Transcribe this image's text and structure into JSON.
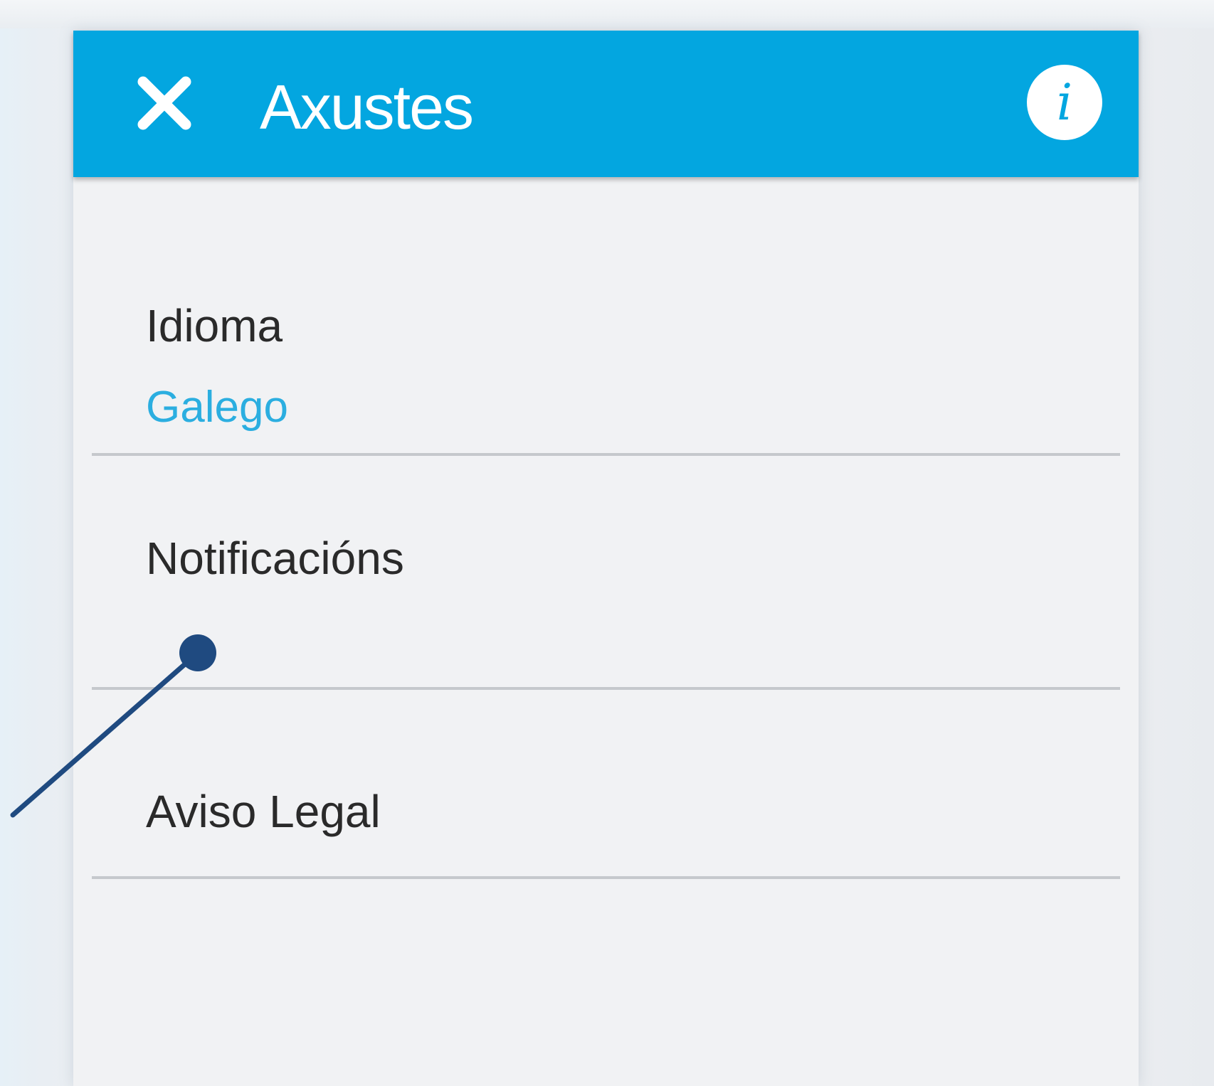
{
  "header": {
    "title": "Axustes",
    "close_icon": "close-icon",
    "info_icon": "info-icon",
    "info_glyph": "i",
    "accent_color": "#03a6e0"
  },
  "settings": {
    "language": {
      "label": "Idioma",
      "value": "Galego",
      "value_color": "#2baee0"
    },
    "notifications": {
      "label": "Notificacións"
    },
    "legal": {
      "label": "Aviso Legal"
    }
  },
  "annotation": {
    "color": "#1f4a80"
  }
}
